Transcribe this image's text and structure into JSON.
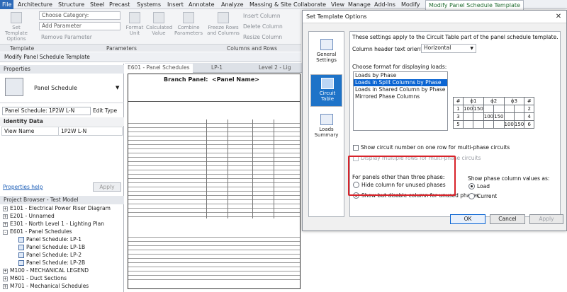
{
  "menubar": {
    "file": "File",
    "tabs": [
      "Architecture",
      "Structure",
      "Steel",
      "Precast",
      "Systems",
      "Insert",
      "Annotate",
      "Analyze",
      "Massing & Site",
      "Collaborate",
      "View",
      "Manage",
      "Add-Ins",
      "Modify"
    ],
    "active_tab": "Modify Panel Schedule Template"
  },
  "ribbon": {
    "set_template_options": "Set Template Options",
    "choose_category": "Choose Category:",
    "add_parameter": "Add Parameter",
    "remove_parameter": "Remove Parameter",
    "format_unit": "Format Unit",
    "calculated_value": "Calculated Value",
    "combine_parameters": "Combine Parameters",
    "freeze_rows": "Freeze Rows and Columns",
    "insert_column": "Insert Column",
    "delete_column": "Delete Column",
    "resize_column": "Resize Column",
    "panel_template": "Template",
    "panel_parameters": "Parameters",
    "panel_columns_rows": "Columns and Rows"
  },
  "context_bar": "Modify Panel Schedule Template",
  "properties": {
    "title": "Properties",
    "type_name": "Panel Schedule",
    "instance_selector": "Panel Schedule: 1P2W L-N",
    "edit_type": "Edit Type",
    "section": "Identity Data",
    "rows": [
      {
        "label": "View Name",
        "value": "1P2W L-N"
      }
    ],
    "help_link": "Properties help",
    "apply": "Apply"
  },
  "browser": {
    "title": "Project Browser - Test Model",
    "items": [
      {
        "label": "E101 - Electrical Power Riser Diagram",
        "level": 0,
        "toggle": "+"
      },
      {
        "label": "E201 - Unnamed",
        "level": 0,
        "toggle": "+"
      },
      {
        "label": "E301 - North Level 1 - Lighting Plan",
        "level": 0,
        "toggle": "+"
      },
      {
        "label": "E601 - Panel Schedules",
        "level": 0,
        "toggle": "-"
      },
      {
        "label": "Panel Schedule: LP-1",
        "level": 1,
        "toggle": ""
      },
      {
        "label": "Panel Schedule: LP-1B",
        "level": 1,
        "toggle": ""
      },
      {
        "label": "Panel Schedule: LP-2",
        "level": 1,
        "toggle": ""
      },
      {
        "label": "Panel Schedule: LP-2B",
        "level": 1,
        "toggle": ""
      },
      {
        "label": "M100 - MECHANICAL LEGEND",
        "level": 0,
        "toggle": "+"
      },
      {
        "label": "M601 - Duct Sections",
        "level": 0,
        "toggle": "+"
      },
      {
        "label": "M701 - Mechanical Schedules",
        "level": 0,
        "toggle": "+"
      }
    ]
  },
  "view_tabs": [
    "E601 - Panel Schedules",
    "LP-1",
    "Level 2 - Lig"
  ],
  "schedule": {
    "heading": "Branch Panel:",
    "panel_name": "<Panel Name>"
  },
  "dialog": {
    "title": "Set Template Options",
    "close": "✕",
    "nav": [
      {
        "label": "General Settings"
      },
      {
        "label": "Circuit Table"
      },
      {
        "label": "Loads Summary"
      }
    ],
    "intro": "These settings apply to the Circuit Table part of the panel schedule template.",
    "orientation_label": "Column header text orientation:",
    "orientation_value": "Horizontal",
    "format_label": "Choose format for displaying loads:",
    "formats": [
      "Loads by Phase",
      "Loads in Split Columns by Phase",
      "Loads in Shared Column by Phase",
      "Mirrored Phase Columns"
    ],
    "selected_format": 1,
    "preview": {
      "headers": [
        "#",
        "ϕ1",
        "ϕ2",
        "ϕ3",
        "#"
      ],
      "rows": [
        [
          "1",
          "100",
          "150",
          "",
          "",
          "",
          "",
          "2"
        ],
        [
          "3",
          "",
          "",
          "100",
          "150",
          "",
          "",
          "4"
        ],
        [
          "5",
          "",
          "",
          "",
          "",
          "100",
          "150",
          "6"
        ]
      ]
    },
    "show_circuit_number": "Show circuit number on one row for multi-phase circuits",
    "display_multiple_rows": "Display multiple rows for multi-phase circuits",
    "panels_group_label": "For panels other than three phase:",
    "hide_unused": "Hide column for unused phases",
    "disable_unused": "Show but disable column for unused phases",
    "phase_values_label": "Show phase column values as:",
    "load": "Load",
    "current": "Current",
    "ok": "OK",
    "cancel": "Cancel",
    "apply": "Apply"
  }
}
